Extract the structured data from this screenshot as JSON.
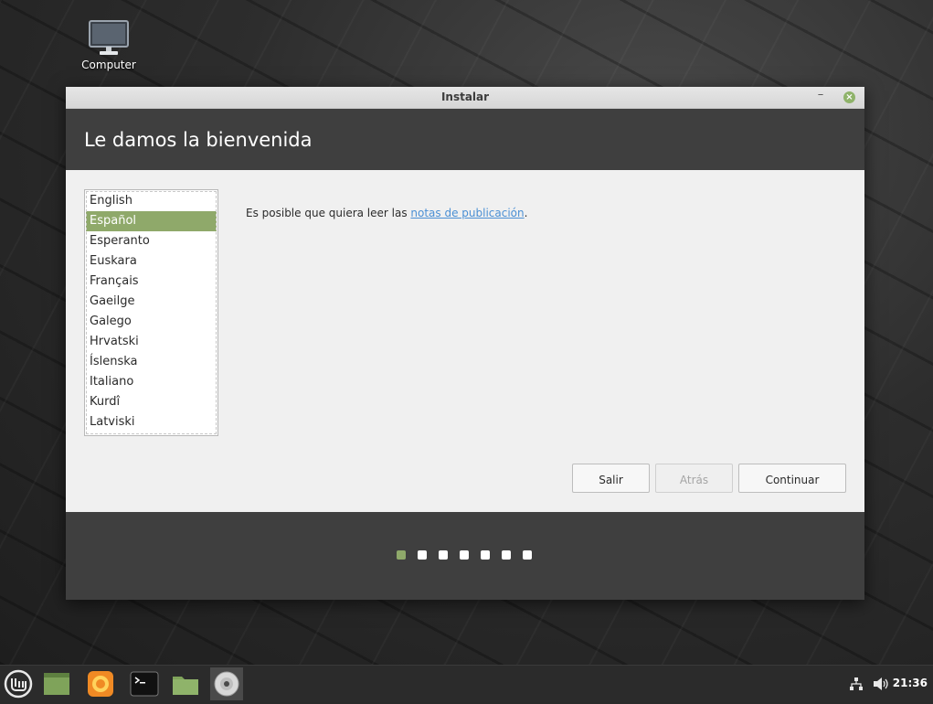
{
  "desktop": {
    "icons": [
      {
        "label": "Computer",
        "icon": "computer-icon"
      }
    ]
  },
  "window": {
    "title": "Instalar",
    "heading": "Le damos la bienvenida",
    "languages": [
      "English",
      "Español",
      "Esperanto",
      "Euskara",
      "Français",
      "Gaeilge",
      "Galego",
      "Hrvatski",
      "Íslenska",
      "Italiano",
      "Kurdî",
      "Latviski"
    ],
    "selected_language": "Español",
    "notes_prefix": "Es posible que quiera leer las ",
    "notes_link": "notas de publicación",
    "notes_suffix": ".",
    "buttons": {
      "quit": "Salir",
      "back": "Atrás",
      "continue": "Continuar"
    },
    "progress": {
      "total_steps": 7,
      "current_step": 1
    }
  },
  "taskbar": {
    "items": [
      "mint-menu-icon",
      "show-desktop-icon",
      "firefox-icon",
      "terminal-icon",
      "files-icon",
      "installer-disc-icon"
    ],
    "clock": "21:36",
    "tray": [
      "network-icon",
      "volume-icon"
    ]
  },
  "colors": {
    "accent": "#8fa96a",
    "header_bg": "#3f3f3f",
    "link": "#4a8fd4"
  }
}
